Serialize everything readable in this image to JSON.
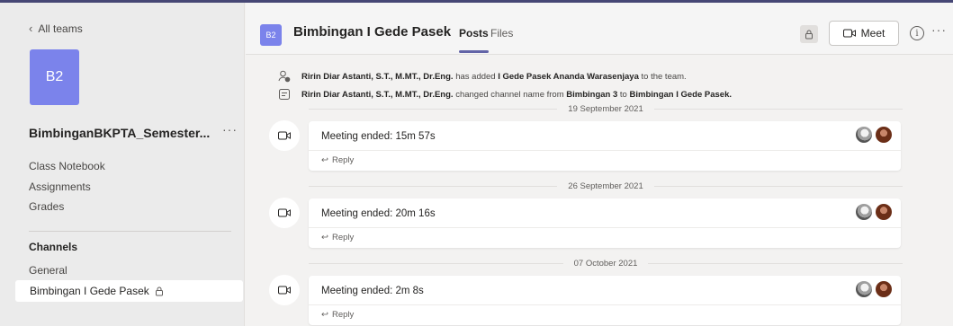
{
  "sidebar": {
    "back_label": "All teams",
    "team_initials": "B2",
    "team_name": "BimbinganBKPTA_Semester...",
    "more": "···",
    "nav": [
      "Class Notebook",
      "Assignments",
      "Grades"
    ],
    "channels_heading": "Channels",
    "channels": [
      "General",
      "Bimbingan I Gede Pasek"
    ]
  },
  "header": {
    "avatar": "B2",
    "title": "Bimbingan I Gede Pasek",
    "tabs": [
      "Posts",
      "Files"
    ],
    "active_tab": "Posts",
    "meet_label": "Meet",
    "info": "i",
    "more": "···"
  },
  "feed": {
    "system_messages": [
      {
        "icon": "person-add-icon",
        "actor": "Ririn Diar Astanti, S.T., M.MT., Dr.Eng.",
        "text": "has added",
        "target": "I Gede Pasek Ananda Warasenjaya",
        "tail": "to the team."
      },
      {
        "icon": "channel-rename-icon",
        "actor": "Ririn Diar Astanti, S.T., M.MT., Dr.Eng.",
        "text": "changed channel name from",
        "target": "Bimbingan 3",
        "mid": "to",
        "target2": "Bimbingan I Gede Pasek."
      }
    ],
    "dates": [
      "19 September 2021",
      "26 September 2021",
      "07 October 2021"
    ],
    "meetings": [
      {
        "title": "Meeting ended: 15m 57s",
        "reply": "Reply"
      },
      {
        "title": "Meeting ended: 20m 16s",
        "reply": "Reply"
      },
      {
        "title": "Meeting ended: 2m 8s",
        "reply": "Reply"
      }
    ]
  },
  "colors": {
    "brand": "#6264a7",
    "team_avatar": "#7b83eb",
    "top_bar": "#464775"
  }
}
